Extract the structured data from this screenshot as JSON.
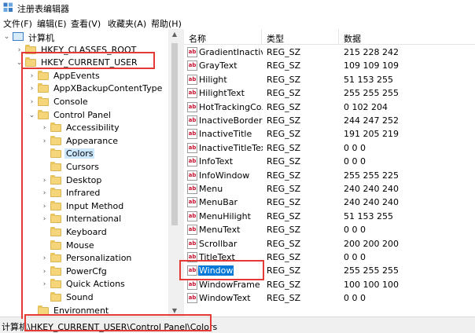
{
  "window": {
    "title": "注册表编辑器"
  },
  "menu": [
    {
      "label": "文件(F)"
    },
    {
      "label": "编辑(E)"
    },
    {
      "label": "查看(V)"
    },
    {
      "label": "收藏夹(A)"
    },
    {
      "label": "帮助(H)"
    }
  ],
  "tree": {
    "items": [
      {
        "label": "计算机",
        "expander": "⌄",
        "icon": "computer-icon"
      },
      {
        "label": "HKEY_CLASSES_ROOT",
        "expander": "›",
        "icon": "folder-icon"
      },
      {
        "label": "HKEY_CURRENT_USER",
        "expander": "⌄",
        "icon": "folder-icon"
      },
      {
        "label": "AppEvents",
        "expander": "›",
        "icon": "folder-icon"
      },
      {
        "label": "AppXBackupContentType",
        "expander": "›",
        "icon": "folder-icon"
      },
      {
        "label": "Console",
        "expander": "›",
        "icon": "folder-icon"
      },
      {
        "label": "Control Panel",
        "expander": "⌄",
        "icon": "folder-icon"
      },
      {
        "label": "Accessibility",
        "expander": "›",
        "icon": "folder-icon"
      },
      {
        "label": "Appearance",
        "expander": "›",
        "icon": "folder-icon"
      },
      {
        "label": "Colors",
        "expander": "",
        "icon": "folder-icon",
        "selected": true
      },
      {
        "label": "Cursors",
        "expander": "",
        "icon": "folder-icon"
      },
      {
        "label": "Desktop",
        "expander": "›",
        "icon": "folder-icon"
      },
      {
        "label": "Infrared",
        "expander": "›",
        "icon": "folder-icon"
      },
      {
        "label": "Input Method",
        "expander": "›",
        "icon": "folder-icon"
      },
      {
        "label": "International",
        "expander": "›",
        "icon": "folder-icon"
      },
      {
        "label": "Keyboard",
        "expander": "",
        "icon": "folder-icon"
      },
      {
        "label": "Mouse",
        "expander": "",
        "icon": "folder-icon"
      },
      {
        "label": "Personalization",
        "expander": "›",
        "icon": "folder-icon"
      },
      {
        "label": "PowerCfg",
        "expander": "›",
        "icon": "folder-icon"
      },
      {
        "label": "Quick Actions",
        "expander": "›",
        "icon": "folder-icon"
      },
      {
        "label": "Sound",
        "expander": "",
        "icon": "folder-icon"
      },
      {
        "label": "Environment",
        "expander": "",
        "icon": "folder-icon"
      }
    ]
  },
  "list": {
    "columns": [
      "名称",
      "类型",
      "数据"
    ],
    "rows": [
      {
        "name": "GradientInactiv...",
        "type": "REG_SZ",
        "data": "215 228 242"
      },
      {
        "name": "GrayText",
        "type": "REG_SZ",
        "data": "109 109 109"
      },
      {
        "name": "Hilight",
        "type": "REG_SZ",
        "data": "51 153 255"
      },
      {
        "name": "HilightText",
        "type": "REG_SZ",
        "data": "255 255 255"
      },
      {
        "name": "HotTrackingCo...",
        "type": "REG_SZ",
        "data": "0 102 204"
      },
      {
        "name": "InactiveBorder",
        "type": "REG_SZ",
        "data": "244 247 252"
      },
      {
        "name": "InactiveTitle",
        "type": "REG_SZ",
        "data": "191 205 219"
      },
      {
        "name": "InactiveTitleText",
        "type": "REG_SZ",
        "data": "0 0 0"
      },
      {
        "name": "InfoText",
        "type": "REG_SZ",
        "data": "0 0 0"
      },
      {
        "name": "InfoWindow",
        "type": "REG_SZ",
        "data": "255 255 225"
      },
      {
        "name": "Menu",
        "type": "REG_SZ",
        "data": "240 240 240"
      },
      {
        "name": "MenuBar",
        "type": "REG_SZ",
        "data": "240 240 240"
      },
      {
        "name": "MenuHilight",
        "type": "REG_SZ",
        "data": "51 153 255"
      },
      {
        "name": "MenuText",
        "type": "REG_SZ",
        "data": "0 0 0"
      },
      {
        "name": "Scrollbar",
        "type": "REG_SZ",
        "data": "200 200 200"
      },
      {
        "name": "TitleText",
        "type": "REG_SZ",
        "data": "0 0 0"
      },
      {
        "name": "Window",
        "type": "REG_SZ",
        "data": "255 255 255",
        "selected": true
      },
      {
        "name": "WindowFrame",
        "type": "REG_SZ",
        "data": "100 100 100"
      },
      {
        "name": "WindowText",
        "type": "REG_SZ",
        "data": "0 0 0"
      }
    ],
    "value_icon_text": "ab"
  },
  "statusbar": {
    "path": "计算机\\HKEY_CURRENT_USER\\Control Panel\\Colors"
  },
  "colors": {
    "selection": "#0078d7",
    "tree_selection": "#cce8ff",
    "annotation": "#e53935",
    "folder": "#f5d57a"
  }
}
